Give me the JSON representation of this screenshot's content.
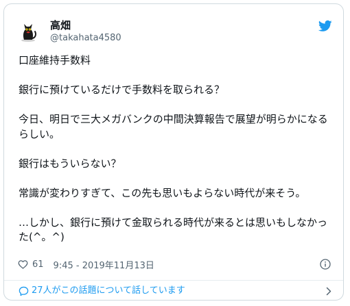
{
  "author": {
    "name": "高畑",
    "handle": "@takahata4580"
  },
  "tweet": {
    "text": "口座維持手数料\n\n銀行に預けているだけで手数料を取られる？\n\n今日、明日で三大メガバンクの中間決算報告で展望が明らかになるらしい。\n\n銀行はもういらない？\n\n常識が変わりすぎて、この先も思いもよらない時代が来そう。\n\n…しかし、銀行に預けて金取られる時代が来るとは思いもしなかった(^。^)"
  },
  "meta": {
    "likes": "61",
    "timestamp": "9:45 - 2019年11月13日"
  },
  "footer": {
    "label": "27人がこの話題について話しています"
  },
  "colors": {
    "accent": "#1d9bf0",
    "text": "#0f1419",
    "muted": "#536471",
    "border": "#cfd9de"
  },
  "icons": {
    "avatar": "black-cat-avatar",
    "brand": "twitter-bird-icon",
    "like": "heart-icon",
    "info": "info-icon",
    "conversation": "speech-bubble-icon",
    "chevron": "chevron-right-icon"
  }
}
